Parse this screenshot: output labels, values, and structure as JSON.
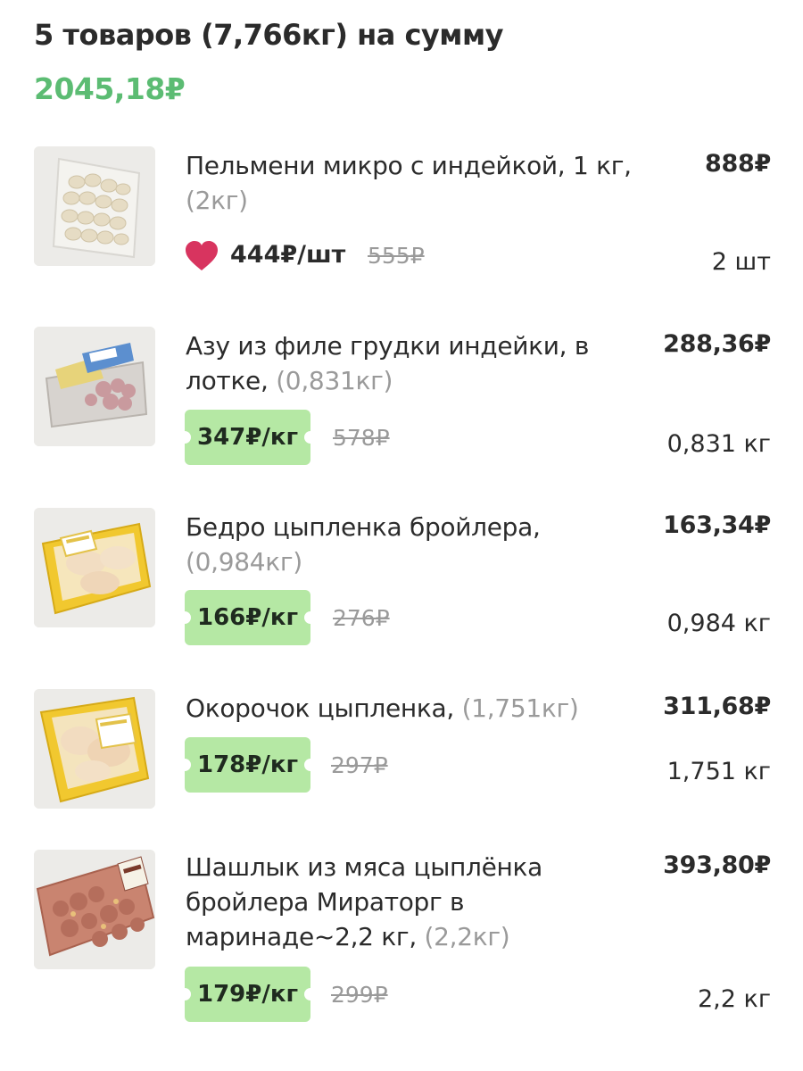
{
  "summary": {
    "title": "5 товаров (7,766кг) на сумму",
    "total": "2045,18₽"
  },
  "colors": {
    "accent_green": "#5cbc73",
    "badge_green": "#b5e8a4",
    "heart_red": "#d8345f",
    "muted_gray": "#9a9a9a"
  },
  "items": [
    {
      "name": "Пельмени микро с индейкой, 1 кг,",
      "weight_note": "(2кг)",
      "price": "444₽/шт",
      "old_price": "555₽",
      "line_total": "888₽",
      "quantity": "2 шт",
      "favorite_icon": "heart-icon"
    },
    {
      "name": "Азу из филе грудки индейки, в лотке,",
      "weight_note": "(0,831кг)",
      "price": "347₽/кг",
      "old_price": "578₽",
      "line_total": "288,36₽",
      "quantity": "0,831 кг"
    },
    {
      "name": "Бедро цыпленка бройлера,",
      "weight_note": "(0,984кг)",
      "price": "166₽/кг",
      "old_price": "276₽",
      "line_total": "163,34₽",
      "quantity": "0,984 кг"
    },
    {
      "name": "Окорочок цыпленка,",
      "weight_note": "(1,751кг)",
      "price": "178₽/кг",
      "old_price": "297₽",
      "line_total": "311,68₽",
      "quantity": "1,751 кг"
    },
    {
      "name": "Шашлык из мяса цыплёнка бройлера Мираторг в маринаде~2,2 кг,",
      "weight_note": "(2,2кг)",
      "price": "179₽/кг",
      "old_price": "299₽",
      "line_total": "393,80₽",
      "quantity": "2,2 кг"
    }
  ]
}
